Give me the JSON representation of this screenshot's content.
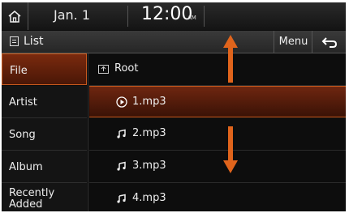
{
  "status_bar": {
    "home_icon": "home-icon",
    "date": "Jan. 1",
    "time": "12:00",
    "ampm": "AM"
  },
  "title_bar": {
    "title": "List",
    "list_icon": "list-icon",
    "menu_label": "Menu",
    "back_icon": "back-arrow-icon"
  },
  "categories": [
    {
      "label": "File",
      "active": true
    },
    {
      "label": "Artist",
      "active": false
    },
    {
      "label": "Song",
      "active": false
    },
    {
      "label": "Album",
      "active": false
    },
    {
      "label": "Recently Added",
      "active": false
    }
  ],
  "files": [
    {
      "label": "Root",
      "icon": "folder-up-icon",
      "active": false
    },
    {
      "label": "1.mp3",
      "icon": "play-circle-icon",
      "active": true
    },
    {
      "label": "2.mp3",
      "icon": "music-note-icon",
      "active": false
    },
    {
      "label": "3.mp3",
      "icon": "music-note-icon",
      "active": false
    },
    {
      "label": "4.mp3",
      "icon": "music-note-icon",
      "active": false
    }
  ],
  "colors": {
    "accent": "#c85a1e",
    "arrow": "#e0641c",
    "background": "#0d0d0d"
  }
}
